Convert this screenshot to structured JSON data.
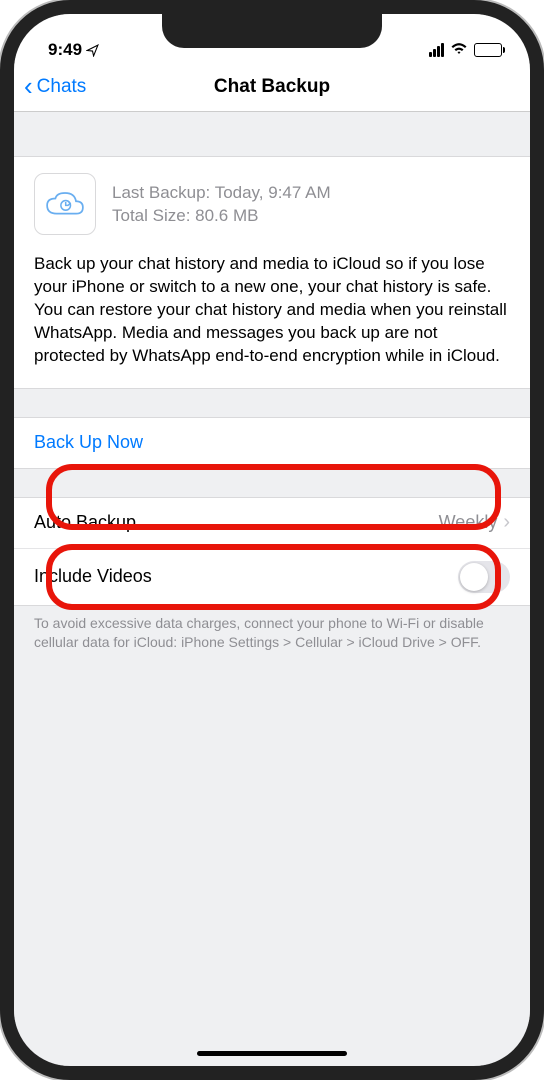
{
  "status": {
    "time": "9:49",
    "location_icon": "location-arrow"
  },
  "nav": {
    "back_label": "Chats",
    "title": "Chat Backup"
  },
  "backup_info": {
    "last_backup_label": "Last Backup: Today, 9:47 AM",
    "total_size_label": "Total Size: 80.6 MB"
  },
  "description": "Back up your chat history and media to iCloud so if you lose your iPhone or switch to a new one, your chat history is safe. You can restore your chat history and media when you reinstall WhatsApp. Media and messages you back up are not protected by WhatsApp end-to-end encryption while in iCloud.",
  "rows": {
    "backup_now": "Back Up Now",
    "auto_backup_label": "Auto Backup",
    "auto_backup_value": "Weekly",
    "include_videos": "Include Videos"
  },
  "footer": "To avoid excessive data charges, connect your phone to Wi-Fi or disable cellular data for iCloud: iPhone Settings > Cellular > iCloud Drive > OFF."
}
